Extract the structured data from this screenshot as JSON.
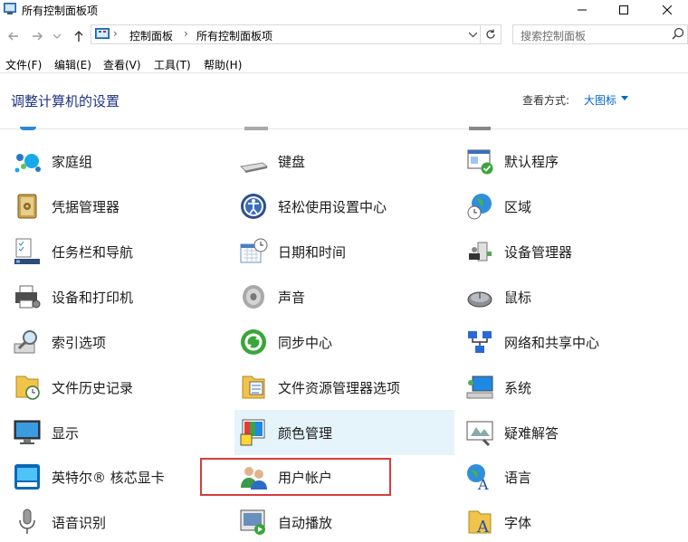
{
  "window": {
    "title": "所有控制面板项"
  },
  "nav": {
    "breadcrumb": [
      "控制面板",
      "所有控制面板项"
    ],
    "search_placeholder": "搜索控制面板"
  },
  "menu": [
    "文件(F)",
    "编辑(E)",
    "查看(V)",
    "工具(T)",
    "帮助(H)"
  ],
  "header": {
    "title": "调整计算机的设置",
    "view_label": "查看方式:",
    "view_value": "大图标"
  },
  "items": [
    {
      "label": "家庭组",
      "icon": "homegroup-icon"
    },
    {
      "label": "键盘",
      "icon": "keyboard-icon"
    },
    {
      "label": "默认程序",
      "icon": "default-programs-icon"
    },
    {
      "label": "凭据管理器",
      "icon": "credential-manager-icon"
    },
    {
      "label": "轻松使用设置中心",
      "icon": "ease-of-access-icon"
    },
    {
      "label": "区域",
      "icon": "region-icon"
    },
    {
      "label": "任务栏和导航",
      "icon": "taskbar-icon"
    },
    {
      "label": "日期和时间",
      "icon": "date-time-icon"
    },
    {
      "label": "设备管理器",
      "icon": "device-manager-icon"
    },
    {
      "label": "设备和打印机",
      "icon": "printer-icon"
    },
    {
      "label": "声音",
      "icon": "speaker-icon"
    },
    {
      "label": "鼠标",
      "icon": "mouse-icon"
    },
    {
      "label": "索引选项",
      "icon": "indexing-icon"
    },
    {
      "label": "同步中心",
      "icon": "sync-center-icon"
    },
    {
      "label": "网络和共享中心",
      "icon": "network-icon"
    },
    {
      "label": "文件历史记录",
      "icon": "file-history-icon"
    },
    {
      "label": "文件资源管理器选项",
      "icon": "folder-options-icon"
    },
    {
      "label": "系统",
      "icon": "system-icon"
    },
    {
      "label": "显示",
      "icon": "display-icon"
    },
    {
      "label": "颜色管理",
      "icon": "color-management-icon"
    },
    {
      "label": "疑难解答",
      "icon": "troubleshooting-icon"
    },
    {
      "label": "英特尔® 核芯显卡",
      "icon": "intel-graphics-icon"
    },
    {
      "label": "用户帐户",
      "icon": "user-accounts-icon"
    },
    {
      "label": "语言",
      "icon": "language-icon"
    },
    {
      "label": "语音识别",
      "icon": "microphone-icon"
    },
    {
      "label": "自动播放",
      "icon": "autoplay-icon"
    },
    {
      "label": "字体",
      "icon": "fonts-icon"
    }
  ],
  "colors": {
    "accent": "#1e3287",
    "link": "#0066cc",
    "highlight": "#e5f3fb",
    "selection_box": "#d63c3c"
  }
}
